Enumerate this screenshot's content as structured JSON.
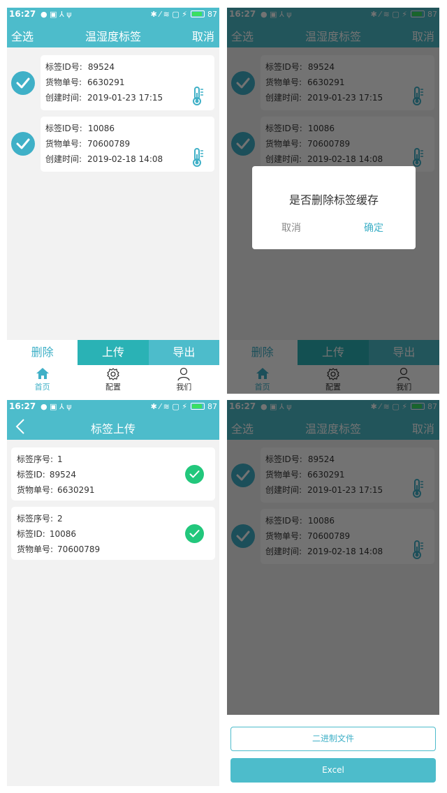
{
  "status": {
    "time": "16:27",
    "battery": "87",
    "left_icons": "● ▣ ⅄ ψ",
    "right_icons": "✱ ⁄ ≋ ▢ ⚡"
  },
  "list_screen": {
    "select_all": "全选",
    "title": "温湿度标签",
    "cancel": "取消",
    "labels": {
      "id": "标签ID号:",
      "cargo": "货物单号:",
      "created": "创建时间:"
    },
    "items": [
      {
        "id": "89524",
        "cargo": "6630291",
        "created": "2019-01-23 17:15"
      },
      {
        "id": "10086",
        "cargo": "70600789",
        "created": "2019-02-18 14:08"
      }
    ],
    "actions": {
      "delete": "删除",
      "upload": "上传",
      "export": "导出"
    },
    "tabs": [
      {
        "label": "首页",
        "icon": "home-icon"
      },
      {
        "label": "配置",
        "icon": "gear-icon"
      },
      {
        "label": "我们",
        "icon": "user-icon"
      }
    ]
  },
  "dialog": {
    "message": "是否删除标签缓存",
    "cancel": "取消",
    "confirm": "确定"
  },
  "upload_screen": {
    "title": "标签上传",
    "labels": {
      "seq": "标签序号:",
      "id": "标签ID:",
      "cargo": "货物单号:"
    },
    "items": [
      {
        "seq": "1",
        "id": "89524",
        "cargo": "6630291"
      },
      {
        "seq": "2",
        "id": "10086",
        "cargo": "70600789"
      }
    ]
  },
  "export_sheet": {
    "binary": "二进制文件",
    "excel": "Excel"
  },
  "colors": {
    "primary": "#4dbccb",
    "accent": "#3fb0c7",
    "upload_bg": "#2ab2b5",
    "success": "#22c77c"
  }
}
